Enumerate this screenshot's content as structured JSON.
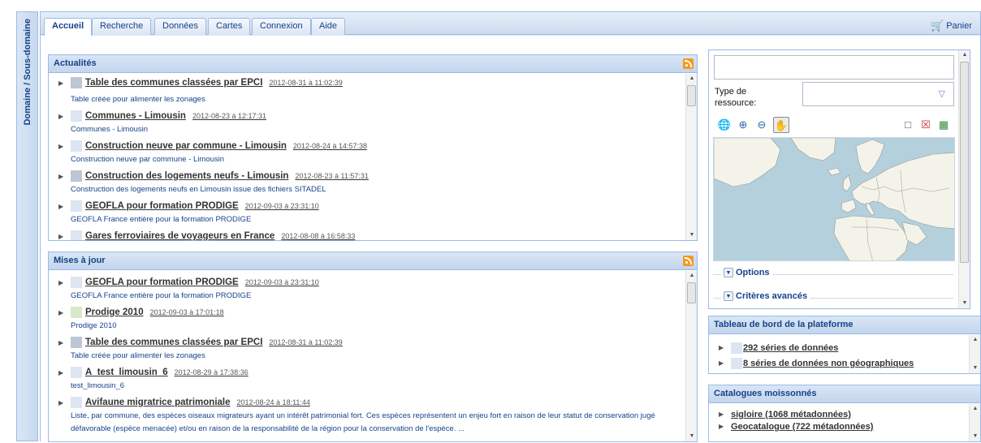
{
  "domain_strip": {
    "label": "Domaine / Sous-domaine"
  },
  "tabs": [
    {
      "label": "Accueil",
      "active": true
    },
    {
      "label": "Recherche"
    },
    {
      "label": "Données"
    },
    {
      "label": "Cartes"
    },
    {
      "label": "Connexion"
    },
    {
      "label": "Aide"
    }
  ],
  "cart": {
    "label": "Panier",
    "icon": "cart-icon"
  },
  "actualites": {
    "title": "Actualités",
    "items": [
      {
        "title": "Table des communes classées par EPCI",
        "date": "2012-08-31 à 11:02:39",
        "desc": "Table créée pour alimenter les zonages"
      },
      {
        "title": "Communes - Limousin",
        "date": "2012-08-23 à 12:17:31",
        "desc": "Communes - Limousin"
      },
      {
        "title": "Construction neuve par commune - Limousin",
        "date": "2012-08-24 à 14:57:38",
        "desc": "Construction neuve par commune - Limousin"
      },
      {
        "title": "Construction des logements neufs - Limousin",
        "date": "2012-08-23 à 11:57:31",
        "desc": "Construction des logements neufs en Limousin issue des fichiers SITADEL"
      },
      {
        "title": "GEOFLA pour formation PRODIGE",
        "date": "2012-09-03 à 23:31:10",
        "desc": "GEOFLA France entière pour la formation PRODIGE"
      },
      {
        "title": "Gares ferroviaires de voyageurs en France",
        "date": "2012-08-08 à 16:58:33",
        "desc": ""
      }
    ]
  },
  "mises_a_jour": {
    "title": "Mises à jour",
    "items": [
      {
        "title": "GEOFLA pour formation PRODIGE",
        "date": "2012-09-03 à 23:31:10",
        "desc": "GEOFLA France entière pour la formation PRODIGE"
      },
      {
        "title": "Prodige 2010",
        "date": "2012-09-03 à 17:01:18",
        "desc": "Prodige 2010"
      },
      {
        "title": "Table des communes classées par EPCI",
        "date": "2012-08-31 à 11:02:39",
        "desc": "Table créée pour alimenter les zonages"
      },
      {
        "title": "A_test_limousin_6",
        "date": "2012-08-29 à 17:38:36",
        "desc": "test_limousin_6"
      },
      {
        "title": "Avifaune migratrice patrimoniale",
        "date": "2012-08-24 à 18:11:44",
        "desc": "Liste, par commune, des espèces oiseaux migrateurs ayant un intérêt patrimonial fort. Ces espèces représentent un enjeu fort en raison de leur statut de conservation jugé défavorable (espèce menacée) et/ou en raison de la responsabilité de la région pour la conservation de l'espèce. ..."
      }
    ]
  },
  "search": {
    "input_value": "",
    "type_label": "Type de ressource:",
    "type_value": "",
    "options_label": "Options",
    "advanced_label": "Critères avancés",
    "tools": [
      "globe-icon",
      "zoom-in-icon",
      "zoom-out-icon",
      "pan-hand-icon",
      "select-box-icon",
      "clear-selection-icon",
      "layers-icon"
    ]
  },
  "tableau": {
    "title": "Tableau de bord de la plateforme",
    "items": [
      "292 séries de données",
      "8 séries de données non géographiques"
    ]
  },
  "catalogues": {
    "title": "Catalogues moissonnés",
    "items": [
      "sigloire (1068 métadonnées)",
      "Geocatalogue (722 métadonnées)"
    ]
  }
}
